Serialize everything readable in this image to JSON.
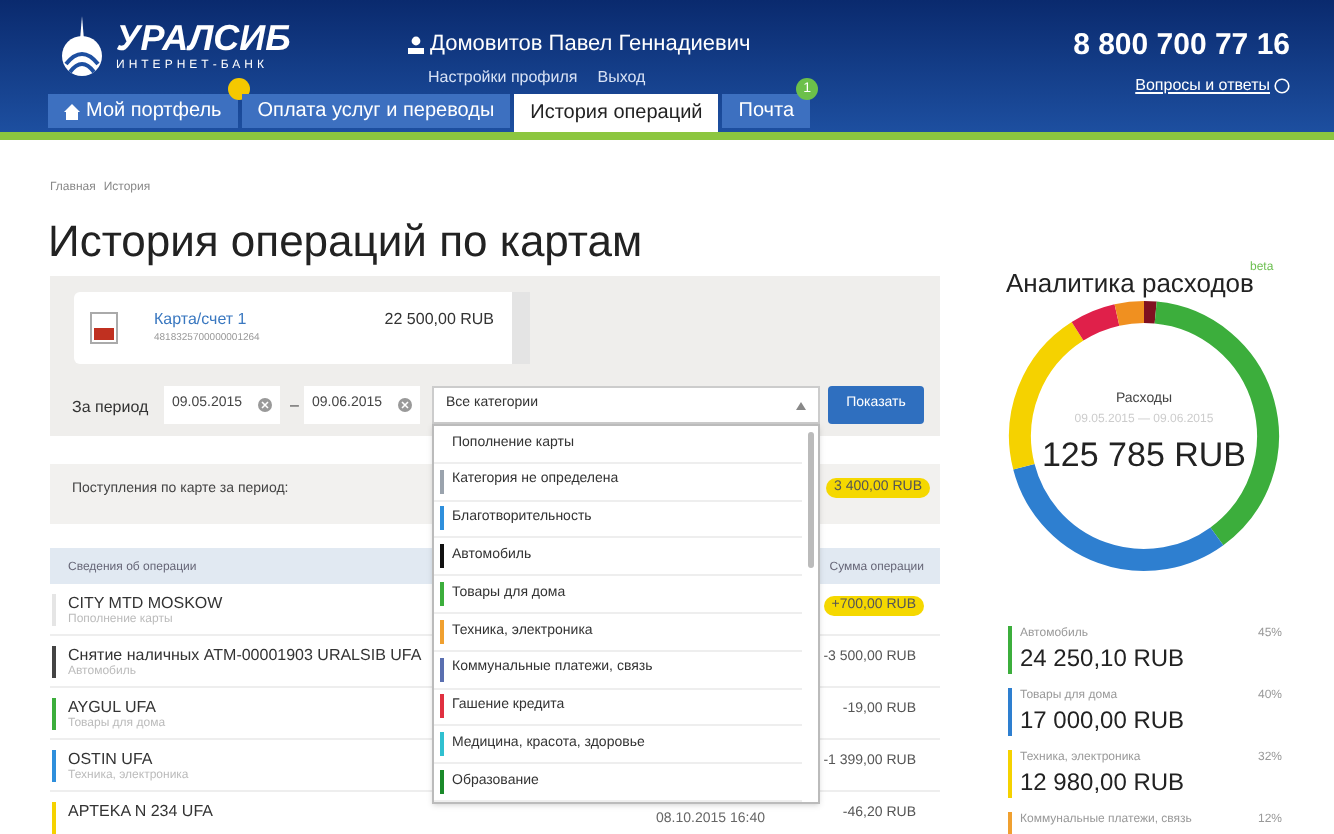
{
  "header": {
    "brand": "УРАЛСИБ",
    "brand_sub": "ИНТЕРНЕТ-БАНК",
    "user": "Домовитов Павел Геннадиевич",
    "profile_links": [
      "Настройки профиля",
      "Выход"
    ],
    "phone": "8 800 700 77 16",
    "faq": "Вопросы и ответы"
  },
  "tabs": [
    {
      "label": "Мой портфель",
      "selected": false,
      "badge_dot": true
    },
    {
      "label": "Оплата услуг и переводы",
      "selected": false
    },
    {
      "label": "История операций",
      "selected": true
    },
    {
      "label": "Почта",
      "selected": false,
      "badge": "1"
    }
  ],
  "breadcrumb": [
    "Главная",
    "История"
  ],
  "title": "История операций по картам",
  "card": {
    "name": "Карта/счет 1",
    "number": "4818325700000001264",
    "balance": "22 500,00 RUB"
  },
  "filter": {
    "label": "За период",
    "from": "09.05.2015",
    "dash": "–",
    "to": "09.06.2015",
    "category": "Все категории",
    "button": "Показать"
  },
  "income": {
    "label": "Поступления по карте за период:",
    "amount": "3 400,00 RUB"
  },
  "table": {
    "columns": [
      "Сведения об операции",
      "Сумма операции"
    ],
    "rows": [
      {
        "name": "CITY MTD MOSKOW",
        "category": "Пополнение карты",
        "date": "",
        "amount": "+700,00 RUB",
        "income": true,
        "color": "#e5e5e5"
      },
      {
        "name": "Снятие наличных ATM-00001903 URALSIB UFA",
        "category": "Автомобиль",
        "date": "",
        "amount": "-3 500,00 RUB",
        "income": false,
        "color": "#444444"
      },
      {
        "name": "AYGUL UFA",
        "category": "Товары для дома",
        "date": "",
        "amount": "-19,00 RUB",
        "income": false,
        "color": "#3cae3c"
      },
      {
        "name": "OSTIN UFA",
        "category": "Техника, электроника",
        "date": "",
        "amount": "-1 399,00 RUB",
        "income": false,
        "color": "#2e8fdc"
      },
      {
        "name": "APTEKA N 234 UFA",
        "category": "",
        "date": "08.10.2015 16:40",
        "amount": "-46,20 RUB",
        "income": false,
        "color": "#f5d200"
      }
    ]
  },
  "dropdown": [
    {
      "label": "Пополнение карты"
    },
    {
      "label": "Категория не определена",
      "color": "#9aa3ad"
    },
    {
      "label": "Благотворительность",
      "color": "#2e8fdc"
    },
    {
      "label": "Автомобиль",
      "color": "#111111"
    },
    {
      "label": "Товары для дома",
      "color": "#3cae3c"
    },
    {
      "label": "Техника, электроника",
      "color": "#f0a030"
    },
    {
      "label": "Коммунальные платежи, связь",
      "color": "#5a6fb0"
    },
    {
      "label": "Гашение кредита",
      "color": "#e03040"
    },
    {
      "label": "Медицина, красота, здоровье",
      "color": "#30c0d0"
    },
    {
      "label": "Образование",
      "color": "#1a8a2a"
    }
  ],
  "analytics": {
    "title": "Аналитика расходов",
    "beta": "beta",
    "center_label": "Расходы",
    "period": "09.05.2015 — 09.06.2015",
    "total": "125 785 RUB",
    "legend": [
      {
        "label": "Автомобиль",
        "percent": "45%",
        "amount": "24 250,10 RUB",
        "color": "#3cae3c"
      },
      {
        "label": "Товары для дома",
        "percent": "40%",
        "amount": "17 000,00 RUB",
        "color": "#2e7fd0"
      },
      {
        "label": "Техника, электроника",
        "percent": "32%",
        "amount": "12 980,00 RUB",
        "color": "#f5d200"
      },
      {
        "label": "Коммунальные платежи, связь",
        "percent": "12%",
        "color": "#f0a030"
      }
    ]
  }
}
